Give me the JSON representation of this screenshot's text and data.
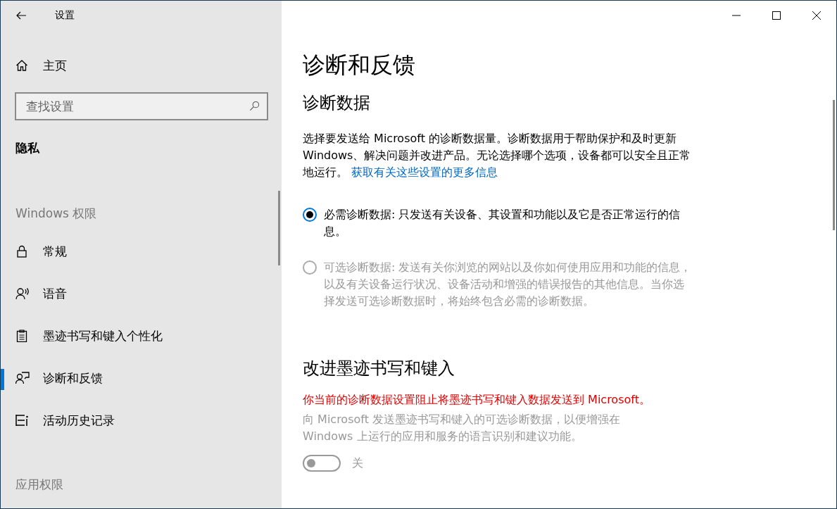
{
  "window": {
    "title": "设置"
  },
  "sidebar": {
    "home": "主页",
    "search": {
      "placeholder": "查找设置"
    },
    "section": "隐私",
    "group_heading": "Windows 权限",
    "items": [
      {
        "label": "常规",
        "selected": false
      },
      {
        "label": "语音",
        "selected": false
      },
      {
        "label": "墨迹书写和键入个性化",
        "selected": false
      },
      {
        "label": "诊断和反馈",
        "selected": true
      },
      {
        "label": "活动历史记录",
        "selected": false
      }
    ],
    "next_heading": "应用权限"
  },
  "main": {
    "title": "诊断和反馈",
    "diagnostics": {
      "heading": "诊断数据",
      "description": "选择要发送给 Microsoft 的诊断数据量。诊断数据用于帮助保护和及时更新 Windows、解决问题并改进产品。无论选择哪个选项，设备都可以安全且正常地运行。",
      "link": "获取有关这些设置的更多信息",
      "options": [
        {
          "label": "必需诊断数据: 只发送有关设备、其设置和功能以及它是否正常运行的信息。",
          "selected": true,
          "disabled": false
        },
        {
          "label": "可选诊断数据: 发送有关你浏览的网站以及你如何使用应用和功能的信息，以及有关设备运行状况、设备活动和增强的错误报告的其他信息。当你选择发送可选诊断数据时，将始终包含必需的诊断数据。",
          "selected": false,
          "disabled": true
        }
      ]
    },
    "inking": {
      "heading": "改进墨迹书写和键入",
      "warning": "你当前的诊断数据设置阻止将墨迹书写和键入数据发送到 Microsoft。",
      "description": "向 Microsoft 发送墨迹书写和键入的可选诊断数据，以便增强在 Windows 上运行的应用和服务的语言识别和建议功能。",
      "toggle": {
        "on": false,
        "disabled": true,
        "label": "关"
      }
    }
  }
}
